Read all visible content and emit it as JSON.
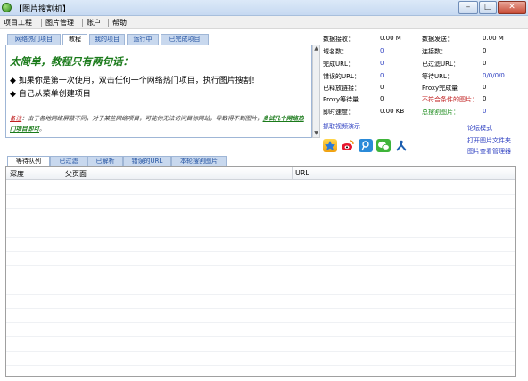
{
  "window": {
    "title": "【图片搜割机】",
    "min": "–",
    "max": "□",
    "close": "✕"
  },
  "menu": [
    "项目工程",
    "图片管理",
    "账户",
    "帮助"
  ],
  "top_tabs": [
    "网络热门项目",
    "教程",
    "我的项目",
    "运行中",
    "已完成项目"
  ],
  "guide": {
    "title": "太简单，教程只有两句话：",
    "line1": "◆ 如果你是第一次使用，双击任何一个网络热门项目，执行图片搜割！",
    "line2": "◆ 自己从菜单创建项目",
    "note_label": "备注",
    "note_text": "：由于各地网络屏蔽不同，对于某些网络项目，可能你无法访问目标网站，导致得不到图片，",
    "note_link": "多试几个网络热门项目即可",
    "note_end": "。"
  },
  "stats": {
    "data_recv": {
      "label": "数据接收：",
      "value": "0.00 M"
    },
    "data_send": {
      "label": "数据发送：",
      "value": "0.00 M"
    },
    "domains": {
      "label": "域名数：",
      "value": "0"
    },
    "links": {
      "label": "连接数：",
      "value": "0"
    },
    "done_url": {
      "label": "完成URL：",
      "value": "0"
    },
    "filtered_url": {
      "label": "已过滤URL：",
      "value": "0"
    },
    "error_url": {
      "label": "错误的URL：",
      "value": "0"
    },
    "waiting": {
      "label": "等待URL：",
      "value": "0/0/0/0"
    },
    "released": {
      "label": "已释放链接：",
      "value": "0"
    },
    "proxy_done": {
      "label": "Proxy完成量",
      "value": "0"
    },
    "proxy_wait": {
      "label": "Proxy等待量",
      "value": "0"
    },
    "unmatched": {
      "label": "不符合条件的图片：",
      "value": "0"
    },
    "speed": {
      "label": "即时速度：",
      "value": "0.00 KB"
    },
    "total_img": {
      "label": "总搜割图片：",
      "value": "0"
    }
  },
  "links": {
    "grab_video": "抓取视频演示",
    "forum_mode": "论坛模式",
    "open_folder": "打开图片文件夹",
    "image_viewer": "图片查看管理器"
  },
  "share_icons": [
    "qzone-icon",
    "weibo-icon",
    "tencent-weibo-icon",
    "wechat-icon",
    "renren-icon"
  ],
  "bottom_tabs": [
    "等待队列",
    "已过滤",
    "已解析",
    "错误的URL",
    "本轮搜割图片"
  ],
  "columns": [
    "深度",
    "父页面",
    "URL"
  ]
}
